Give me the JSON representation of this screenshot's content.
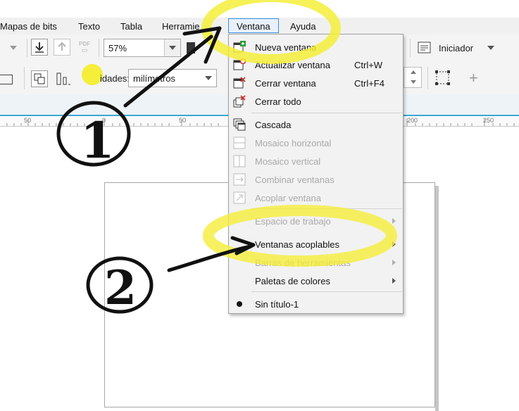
{
  "menubar": {
    "items": [
      {
        "label": "Mapas de bits"
      },
      {
        "label": "Texto"
      },
      {
        "label": "Tabla"
      },
      {
        "label": "Herramie"
      },
      {
        "label": "Ventana"
      },
      {
        "label": "Ayuda"
      }
    ]
  },
  "toolbar": {
    "pdf_label": "PDF",
    "zoom_value": "57%",
    "units_label": "idades:",
    "units_value": "milímetros",
    "launcher_label": "Iniciador",
    "plus_label": "+"
  },
  "ruler": {
    "labels": [
      "50",
      "0",
      "50",
      "200",
      "250"
    ]
  },
  "menu": {
    "items": [
      {
        "label": "Nueva ventana",
        "shortcut": "",
        "enabled": true,
        "icon": "new-window-icon"
      },
      {
        "label": "Actualizar ventana",
        "shortcut": "Ctrl+W",
        "enabled": true,
        "icon": "refresh-window-icon"
      },
      {
        "label": "Cerrar ventana",
        "shortcut": "Ctrl+F4",
        "enabled": true,
        "icon": "close-window-icon"
      },
      {
        "label": "Cerrar todo",
        "shortcut": "",
        "enabled": true,
        "icon": "close-all-icon"
      },
      {
        "label": "Cascada",
        "shortcut": "",
        "enabled": true,
        "icon": "cascade-icon"
      },
      {
        "label": "Mosaico horizontal",
        "shortcut": "",
        "enabled": false,
        "icon": "tile-horizontal-icon"
      },
      {
        "label": "Mosaico vertical",
        "shortcut": "",
        "enabled": false,
        "icon": "tile-vertical-icon"
      },
      {
        "label": "Combinar ventanas",
        "shortcut": "",
        "enabled": false,
        "icon": "combine-windows-icon"
      },
      {
        "label": "Acoplar ventana",
        "shortcut": "",
        "enabled": false,
        "icon": "dock-window-icon"
      },
      {
        "label": "Espacio de trabajo",
        "shortcut": "",
        "enabled": false,
        "submenu": true
      },
      {
        "label": "Ventanas acoplables",
        "shortcut": "",
        "enabled": true,
        "submenu": true
      },
      {
        "label": "Barras de herramientas",
        "shortcut": "",
        "enabled": false,
        "submenu": true
      },
      {
        "label": "Paletas de colores",
        "shortcut": "",
        "enabled": true,
        "submenu": true
      },
      {
        "label": "Sin título-1",
        "shortcut": "",
        "enabled": true,
        "bullet": true
      }
    ]
  },
  "annotations": {
    "marker_1": "1",
    "marker_2": "2",
    "highlight_color": "#f5ee3a"
  },
  "colors": {
    "accent": "#3aa7d3",
    "menu_active_border": "#3b8ee0",
    "menu_bg": "#f2f2f2",
    "icon_green": "#2e9b3a",
    "icon_red": "#d0312d"
  }
}
